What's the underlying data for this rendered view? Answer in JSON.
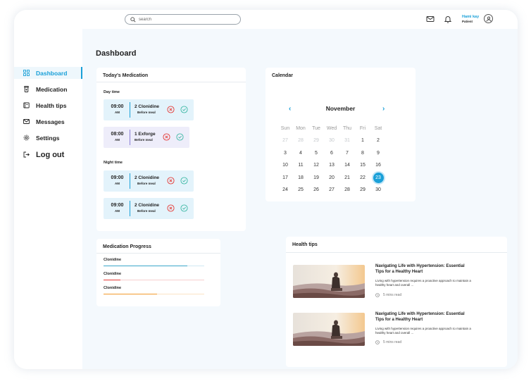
{
  "search": {
    "placeholder": "search"
  },
  "user": {
    "name": "Hami kay",
    "role": "Patient"
  },
  "sidebar": {
    "items": [
      {
        "label": "Dashboard",
        "icon": "grid-icon",
        "active": true
      },
      {
        "label": "Medication",
        "icon": "pill-bottle-icon"
      },
      {
        "label": "Health tips",
        "icon": "book-icon"
      },
      {
        "label": "Messages",
        "icon": "mail-icon"
      },
      {
        "label": "Settings",
        "icon": "gear-icon"
      },
      {
        "label": "Log out",
        "icon": "logout-icon"
      }
    ]
  },
  "page": {
    "title": "Dashboard"
  },
  "medication": {
    "title": "Today's Medication",
    "day_label": "Day time",
    "night_label": "Night time",
    "day": [
      {
        "time": "09:00",
        "ampm": "AM",
        "name": "2 Clonidine",
        "note": "Before meal"
      },
      {
        "time": "08:00",
        "ampm": "AM",
        "name": "1 Exforge",
        "note": "Before meal"
      }
    ],
    "night": [
      {
        "time": "09:00",
        "ampm": "AM",
        "name": "2 Clonidine",
        "note": "Before meal"
      },
      {
        "time": "09:00",
        "ampm": "AM",
        "name": "2 Clonidine",
        "note": "Before meal"
      }
    ]
  },
  "calendar": {
    "title": "Calendar",
    "month": "November",
    "prev": "‹",
    "next": "›",
    "days_of_week": [
      "Sun",
      "Mon",
      "Tue",
      "Wed",
      "Thu",
      "Fri",
      "Sat"
    ],
    "weeks": [
      [
        "27",
        "28",
        "29",
        "30",
        "31",
        "1",
        "2"
      ],
      [
        "3",
        "4",
        "5",
        "6",
        "7",
        "8",
        "9"
      ],
      [
        "10",
        "11",
        "12",
        "13",
        "14",
        "15",
        "16"
      ],
      [
        "17",
        "18",
        "19",
        "20",
        "21",
        "22",
        "23"
      ],
      [
        "24",
        "25",
        "26",
        "27",
        "28",
        "29",
        "30"
      ]
    ],
    "selected": "23"
  },
  "progress": {
    "title": "Medication Progress",
    "items": [
      {
        "label": "Clonidine",
        "fraction": 0.83,
        "color": "#3aa6c9",
        "track": "#cfe9f3"
      },
      {
        "label": "Clonidine",
        "fraction": 0.17,
        "color": "#e53935",
        "track": "#f6cfcf"
      },
      {
        "label": "Clonidine",
        "fraction": 0.53,
        "color": "#f39a2b",
        "track": "#fbe3c5"
      }
    ]
  },
  "tips": {
    "title": "Health tips",
    "items": [
      {
        "title": "Navigating Life with Hypertension: Essential Tips for a Healthy Heart",
        "body": "Living with hypertension requires a proactive approach to maintain a healthy heart and overall ...",
        "read": "5 mins read"
      },
      {
        "title": "Navigating Life with Hypertension: Essential Tips for a Healthy Heart",
        "body": "Living with hypertension requires a proactive approach to maintain a healthy heart and overall ...",
        "read": "5 mins read"
      }
    ]
  },
  "colors": {
    "accent": "#1aa0d8",
    "reject": "#e53935",
    "accept": "#3db8a4"
  }
}
